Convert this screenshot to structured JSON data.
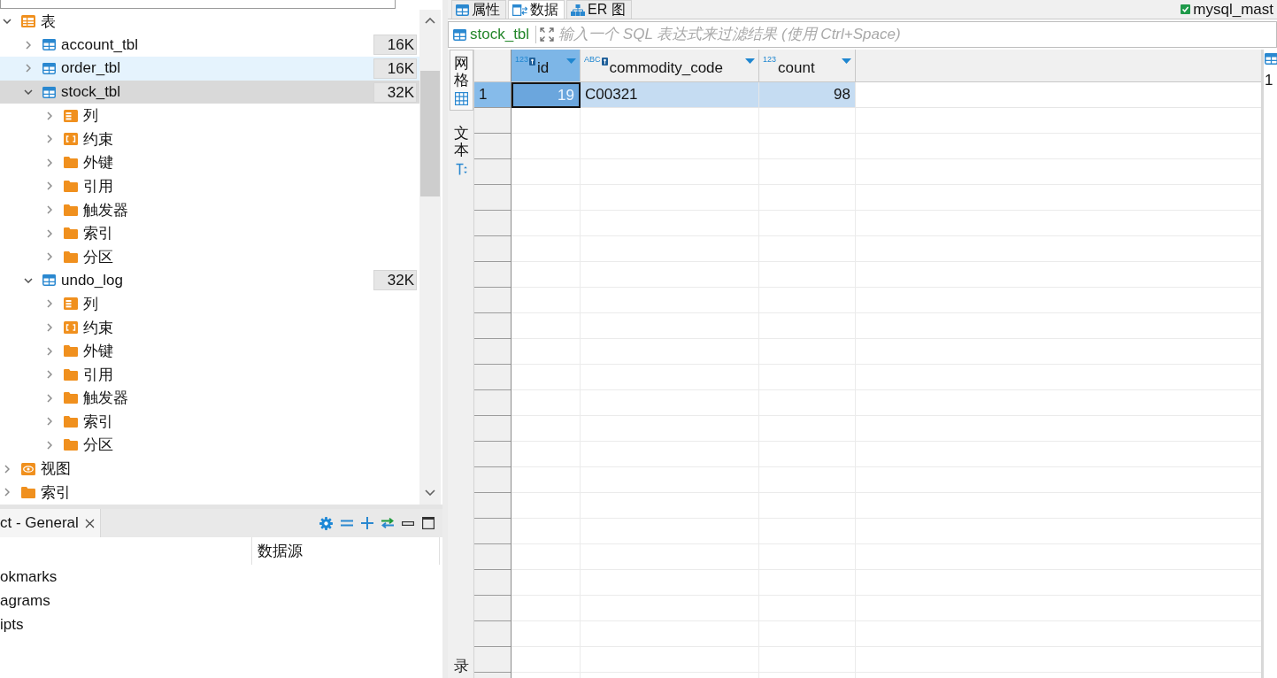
{
  "navigator": {
    "tree": [
      {
        "kind": "table-group",
        "label": "表",
        "expanded": true,
        "selected": false,
        "hovered": false,
        "children": [
          {
            "kind": "table",
            "label": "account_tbl",
            "size": "16K",
            "expanded": false,
            "selected": false,
            "hovered": false
          },
          {
            "kind": "table",
            "label": "order_tbl",
            "size": "16K",
            "expanded": false,
            "selected": false,
            "hovered": true
          },
          {
            "kind": "table",
            "label": "stock_tbl",
            "size": "32K",
            "expanded": true,
            "selected": true,
            "hovered": false,
            "children": [
              {
                "kind": "columns",
                "label": "列",
                "expanded": false,
                "selected": false,
                "hovered": false
              },
              {
                "kind": "constraints",
                "label": "约束",
                "expanded": false,
                "selected": false,
                "hovered": false
              },
              {
                "kind": "folder",
                "label": "外键",
                "expanded": false,
                "selected": false,
                "hovered": false
              },
              {
                "kind": "folder",
                "label": "引用",
                "expanded": false,
                "selected": false,
                "hovered": false
              },
              {
                "kind": "folder",
                "label": "触发器",
                "expanded": false,
                "selected": false,
                "hovered": false
              },
              {
                "kind": "folder",
                "label": "索引",
                "expanded": false,
                "selected": false,
                "hovered": false
              },
              {
                "kind": "folder",
                "label": "分区",
                "expanded": false,
                "selected": false,
                "hovered": false
              }
            ]
          },
          {
            "kind": "table",
            "label": "undo_log",
            "size": "32K",
            "expanded": true,
            "selected": false,
            "hovered": false,
            "children": [
              {
                "kind": "columns",
                "label": "列",
                "expanded": false,
                "selected": false,
                "hovered": false
              },
              {
                "kind": "constraints",
                "label": "约束",
                "expanded": false,
                "selected": false,
                "hovered": false
              },
              {
                "kind": "folder",
                "label": "外键",
                "expanded": false,
                "selected": false,
                "hovered": false
              },
              {
                "kind": "folder",
                "label": "引用",
                "expanded": false,
                "selected": false,
                "hovered": false
              },
              {
                "kind": "folder",
                "label": "触发器",
                "expanded": false,
                "selected": false,
                "hovered": false
              },
              {
                "kind": "folder",
                "label": "索引",
                "expanded": false,
                "selected": false,
                "hovered": false
              },
              {
                "kind": "folder",
                "label": "分区",
                "expanded": false,
                "selected": false,
                "hovered": false
              }
            ]
          }
        ]
      },
      {
        "kind": "view-group",
        "label": "视图",
        "expanded": false,
        "selected": false,
        "hovered": false
      },
      {
        "kind": "folder",
        "label": "索引",
        "expanded": false,
        "selected": false,
        "hovered": false
      }
    ]
  },
  "projects": {
    "tab": {
      "label": "ct - General"
    },
    "column_2": "数据源",
    "items": [
      "okmarks",
      "agrams",
      "ipts"
    ]
  },
  "editor": {
    "tabs": [
      {
        "kind": "properties",
        "label": "属性",
        "selected": false
      },
      {
        "kind": "data",
        "label": "数据",
        "selected": true
      },
      {
        "kind": "er",
        "label": "ER 图",
        "selected": false
      }
    ],
    "connection": "mysql_mast",
    "filter": {
      "table": "stock_tbl",
      "placeholder": "输入一个 SQL 表达式来过滤结果 (使用 Ctrl+Space)"
    },
    "view_tabs": [
      {
        "kind": "grid",
        "label": "网格",
        "selected": true
      },
      {
        "kind": "text",
        "label": "文本",
        "selected": false
      },
      {
        "kind": "record",
        "label": "录",
        "selected": false
      }
    ],
    "grid": {
      "columns": [
        {
          "label": "id",
          "kind": "number",
          "type_badge": "123",
          "key": true,
          "selected": true
        },
        {
          "label": "commodity_code",
          "kind": "string",
          "type_badge": "ABC",
          "key": true,
          "selected": false
        },
        {
          "label": "count",
          "kind": "number",
          "type_badge": "123",
          "key": false,
          "selected": false
        }
      ],
      "rows": [
        {
          "number": "1",
          "selected": true,
          "cells": [
            {
              "value": "19",
              "focused": true
            },
            {
              "value": "C00321",
              "focused": false
            },
            {
              "value": "98",
              "focused": false
            }
          ]
        }
      ]
    },
    "side_panel": {
      "text": "1"
    }
  }
}
